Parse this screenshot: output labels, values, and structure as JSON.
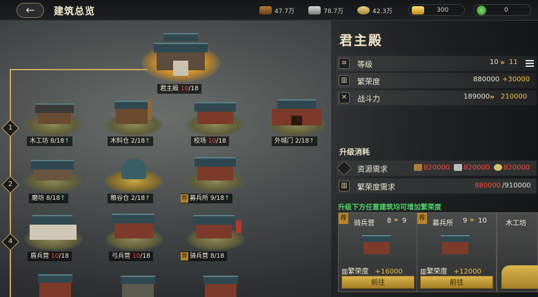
{
  "header": {
    "back_glyph": "←",
    "title": "建筑总览",
    "resources": {
      "wood": "47.7万",
      "iron": "78.7万",
      "grain": "42.3万",
      "gold": "300",
      "jade": "0"
    }
  },
  "buildings": {
    "main": {
      "name": "君主殿",
      "level": "10",
      "max": "/18"
    },
    "tier_labels": [
      "1",
      "2",
      "4"
    ],
    "row1": [
      {
        "name": "木工坊",
        "level": "8",
        "max": "/18",
        "up": "↑"
      },
      {
        "name": "木料仓",
        "level": "2",
        "max": "/18",
        "up": "↑"
      },
      {
        "name": "校场",
        "level": "10",
        "max": "/18"
      },
      {
        "name": "外城门",
        "level": "2",
        "max": "/18",
        "up": "↑"
      }
    ],
    "row2": [
      {
        "name": "磨坊",
        "level": "8",
        "max": "/18",
        "up": "↑"
      },
      {
        "name": "粮谷仓",
        "level": "2",
        "max": "/18",
        "up": "↑"
      },
      {
        "name": "募兵所",
        "level": "9",
        "max": "/18",
        "up": "↑",
        "badge": "荐"
      }
    ],
    "row3": [
      {
        "name": "盾兵营",
        "level": "10",
        "max": "/18"
      },
      {
        "name": "弓兵营",
        "level": "10",
        "max": "/18"
      },
      {
        "name": "骑兵营",
        "level": "8",
        "max": "/18",
        "badge": "荐"
      }
    ]
  },
  "panel": {
    "title": "君主殿",
    "stats": [
      {
        "icon": "rank-icon",
        "label": "等级",
        "current": "10",
        "next": "11"
      },
      {
        "icon": "prosperity-icon",
        "label": "繁荣度",
        "current": "880000",
        "next": "+30000"
      },
      {
        "icon": "power-icon",
        "label": "战斗力",
        "current": "189000",
        "next": "210000"
      }
    ],
    "upgrade_title": "升级消耗",
    "resource_need_label": "资源需求",
    "resource_costs": [
      "820000",
      "820000",
      "820000"
    ],
    "prosperity_need_label": "繁荣度需求",
    "prosperity_have": "880000",
    "prosperity_need": "/910000",
    "tip": "升级下方任意建筑均可增加繁荣度",
    "cards": [
      {
        "name": "骑兵营",
        "from": "8",
        "to": "9",
        "prosp_label": "繁荣度",
        "gain": "+16000",
        "button": "前往",
        "badge": "荐"
      },
      {
        "name": "募兵所",
        "from": "9",
        "to": "10",
        "prosp_label": "繁荣度",
        "gain": "+12000",
        "button": "前往",
        "badge": "荐"
      },
      {
        "name": "木工坊"
      }
    ]
  },
  "colors": {
    "accent_gold": "#f0c040",
    "red_level": "#ff4a3a",
    "green_up": "#49d25c",
    "tip_green": "#4fd06a"
  }
}
